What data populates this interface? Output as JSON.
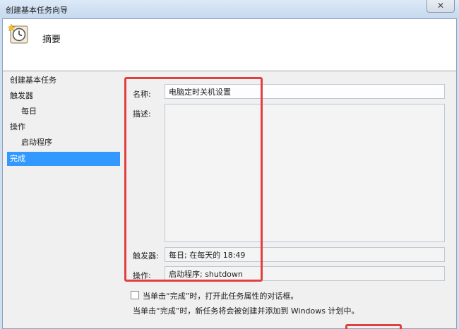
{
  "window": {
    "title": "创建基本任务向导",
    "close_symbol": "✕"
  },
  "header": {
    "title": "摘要",
    "icon": "task-scheduler-clock-icon"
  },
  "sidebar": {
    "items": [
      {
        "label": "创建基本任务",
        "sub": false,
        "active": false
      },
      {
        "label": "触发器",
        "sub": false,
        "active": false
      },
      {
        "label": "每日",
        "sub": true,
        "active": false
      },
      {
        "label": "操作",
        "sub": false,
        "active": false
      },
      {
        "label": "启动程序",
        "sub": true,
        "active": false
      },
      {
        "label": "完成",
        "sub": false,
        "active": true
      }
    ]
  },
  "summary": {
    "name_label": "名称:",
    "name_value": "电脑定时关机设置",
    "description_label": "描述:",
    "description_value": "",
    "trigger_label": "触发器:",
    "trigger_value": "每日; 在每天的 18:49",
    "action_label": "操作:",
    "action_value": "启动程序; shutdown"
  },
  "options": {
    "open_properties_label": "当单击“完成”时，打开此任务属性的对话框。",
    "open_properties_checked": false,
    "info_text": "当单击“完成”时，新任务将会被创建并添加到 Windows 计划中。"
  },
  "colors": {
    "active_nav": "#3399ff",
    "highlight_box": "#e0403f"
  }
}
